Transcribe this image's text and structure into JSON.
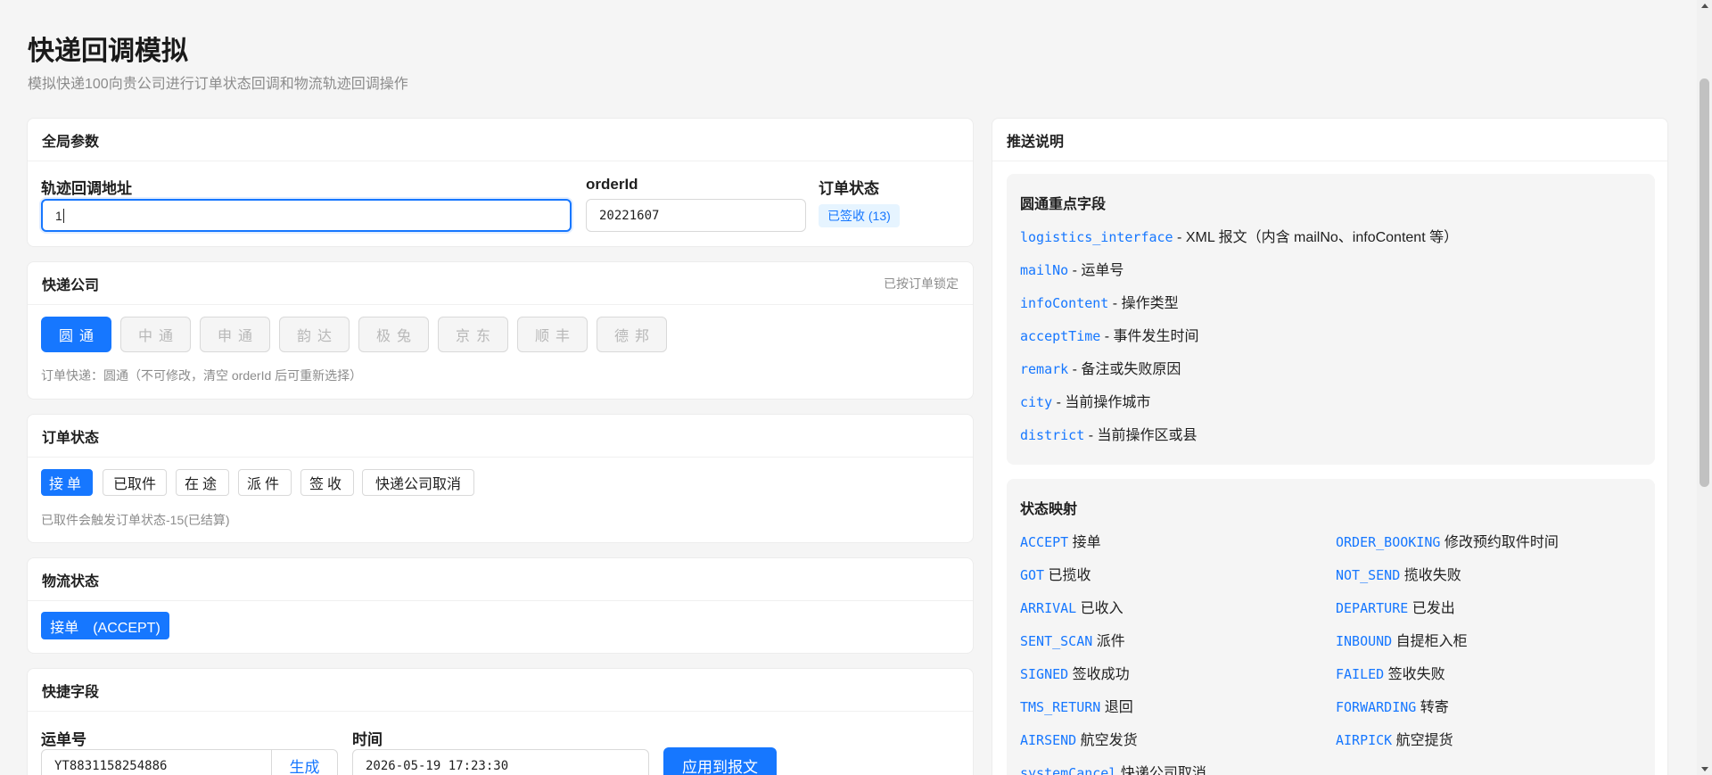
{
  "page": {
    "title": "快递回调模拟",
    "subtitle": "模拟快递100向贵公司进行订单状态回调和物流轨迹回调操作"
  },
  "global": {
    "title": "全局参数",
    "callback_label": "轨迹回调地址",
    "callback_value": "1",
    "orderid_label": "orderId",
    "orderid_value": "20221607",
    "status_label": "订单状态",
    "status_value": "已签收 (13)"
  },
  "courier": {
    "title": "快递公司",
    "extra": "已按订单锁定",
    "options": [
      "圆通",
      "中通",
      "申通",
      "韵达",
      "极兔",
      "京东",
      "顺丰",
      "德邦"
    ],
    "selected": "圆通",
    "hint": "订单快递：圆通（不可修改，清空 orderId 后可重新选择）"
  },
  "order_status": {
    "title": "订单状态",
    "options": [
      "接单",
      "已取件",
      "在途",
      "派件",
      "签收",
      "快递公司取消"
    ],
    "selected": "接单",
    "hint": "已取件会触发订单状态-15(已结算)"
  },
  "logistics": {
    "title": "物流状态",
    "tag": "接单　(ACCEPT)"
  },
  "quick": {
    "title": "快捷字段",
    "waybill_label": "运单号",
    "waybill_value": "YT8831158254886",
    "generate_label": "生成",
    "time_label": "时间",
    "time_value": "2026-05-19 17:23:30",
    "apply_label": "应用到报文"
  },
  "push": {
    "title": "推送说明",
    "fields_title": "圆通重点字段",
    "fields": [
      {
        "code": "logistics_interface",
        "desc": " - XML 报文（内含 mailNo、infoContent 等）"
      },
      {
        "code": "mailNo",
        "desc": " - 运单号"
      },
      {
        "code": "infoContent",
        "desc": " - 操作类型"
      },
      {
        "code": "acceptTime",
        "desc": " - 事件发生时间"
      },
      {
        "code": "remark",
        "desc": " - 备注或失败原因"
      },
      {
        "code": "city",
        "desc": " - 当前操作城市"
      },
      {
        "code": "district",
        "desc": " - 当前操作区或县"
      }
    ],
    "mapping_title": "状态映射",
    "mapping": [
      {
        "code": "ACCEPT",
        "desc": " 接单"
      },
      {
        "code": "ORDER_BOOKING",
        "desc": " 修改预约取件时间"
      },
      {
        "code": "GOT",
        "desc": " 已揽收"
      },
      {
        "code": "NOT_SEND",
        "desc": " 揽收失败"
      },
      {
        "code": "ARRIVAL",
        "desc": " 已收入"
      },
      {
        "code": "DEPARTURE",
        "desc": " 已发出"
      },
      {
        "code": "SENT_SCAN",
        "desc": " 派件"
      },
      {
        "code": "INBOUND",
        "desc": " 自提柜入柜"
      },
      {
        "code": "SIGNED",
        "desc": " 签收成功"
      },
      {
        "code": "FAILED",
        "desc": " 签收失败"
      },
      {
        "code": "TMS_RETURN",
        "desc": " 退回"
      },
      {
        "code": "FORWARDING",
        "desc": " 转寄"
      },
      {
        "code": "AIRSEND",
        "desc": " 航空发货"
      },
      {
        "code": "AIRPICK",
        "desc": " 航空提货"
      },
      {
        "code": "systemCancel",
        "desc": " 快递公司取消"
      }
    ]
  },
  "colors": {
    "accent": "#1677ff",
    "background": "#f5f5f5"
  }
}
